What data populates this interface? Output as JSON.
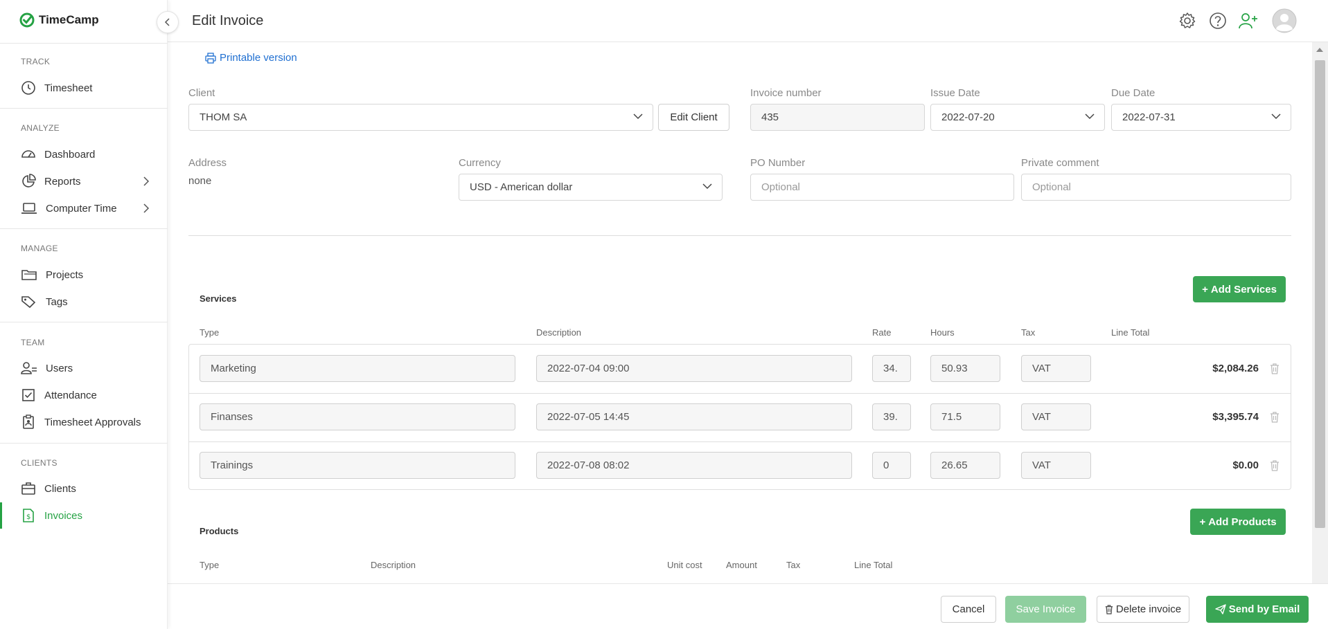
{
  "app": {
    "logo_text": "TimeCamp",
    "brand_color": "#25a244"
  },
  "sidebar": {
    "sections": [
      {
        "label": "TRACK"
      },
      {
        "label": "ANALYZE"
      },
      {
        "label": "MANAGE"
      },
      {
        "label": "TEAM"
      },
      {
        "label": "CLIENTS"
      }
    ],
    "items": [
      {
        "label": "Timesheet",
        "icon": "clock-icon"
      },
      {
        "label": "Dashboard",
        "icon": "dashboard-icon"
      },
      {
        "label": "Reports",
        "icon": "pie-chart-icon"
      },
      {
        "label": "Computer Time",
        "icon": "laptop-icon"
      },
      {
        "label": "Projects",
        "icon": "folder-icon"
      },
      {
        "label": "Tags",
        "icon": "tag-icon"
      },
      {
        "label": "Users",
        "icon": "users-icon"
      },
      {
        "label": "Attendance",
        "icon": "checkbox-icon"
      },
      {
        "label": "Timesheet Approvals",
        "icon": "clipboard-icon"
      },
      {
        "label": "Clients",
        "icon": "briefcase-icon"
      },
      {
        "label": "Invoices",
        "icon": "invoice-icon",
        "active": true
      }
    ]
  },
  "header": {
    "title": "Edit Invoice"
  },
  "form": {
    "printable_label": "Printable version",
    "client": {
      "label": "Client",
      "value": "THOM SA",
      "edit_button": "Edit Client"
    },
    "invoice_number": {
      "label": "Invoice number",
      "value": "435"
    },
    "issue_date": {
      "label": "Issue Date",
      "value": "2022-07-20"
    },
    "due_date": {
      "label": "Due Date",
      "value": "2022-07-31"
    },
    "address": {
      "label": "Address",
      "value": "none"
    },
    "currency": {
      "label": "Currency",
      "value": "USD - American dollar"
    },
    "po_number": {
      "label": "PO Number",
      "placeholder": "Optional"
    },
    "private_comment": {
      "label": "Private comment",
      "placeholder": "Optional"
    }
  },
  "services": {
    "title": "Services",
    "add_button": "Add Services",
    "columns": [
      "Type",
      "Description",
      "Rate",
      "Hours",
      "Tax",
      "Line Total"
    ],
    "rows": [
      {
        "type": "Marketing",
        "description": "2022-07-04 09:00",
        "rate": "34.",
        "hours": "50.93",
        "tax": "VAT",
        "total": "$2,084.26"
      },
      {
        "type": "Finanses",
        "description": "2022-07-05 14:45",
        "rate": "39.",
        "hours": "71.5",
        "tax": "VAT",
        "total": "$3,395.74"
      },
      {
        "type": "Trainings",
        "description": "2022-07-08 08:02",
        "rate": "0",
        "hours": "26.65",
        "tax": "VAT",
        "total": "$0.00"
      }
    ]
  },
  "products": {
    "title": "Products",
    "add_button": "Add Products",
    "columns": [
      "Type",
      "Description",
      "Unit cost",
      "Amount",
      "Tax",
      "Line Total"
    ]
  },
  "footer": {
    "cancel": "Cancel",
    "save": "Save Invoice",
    "delete": "Delete invoice",
    "send": "Send by Email"
  }
}
